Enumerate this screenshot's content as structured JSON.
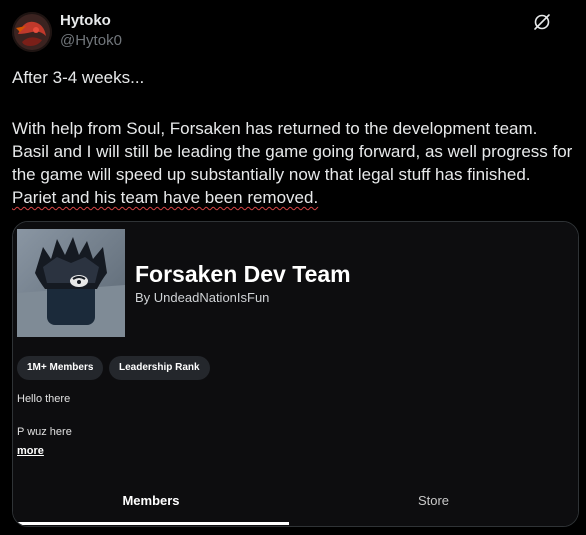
{
  "author": {
    "display_name": "Hytoko",
    "handle": "@Hytok0",
    "avatar_icon": "avatar-image"
  },
  "header_icons": {
    "grok_icon": "grok-icon"
  },
  "post": {
    "line1": "After 3-4 weeks...",
    "paragraph_main": "With help from Soul, Forsaken has returned to the development team. Basil and I will still be leading the game going forward, as well progress for the game will speed up substantially now that legal stuff has finished.",
    "paragraph_underlined": "Pariet and his team have been removed."
  },
  "card": {
    "title": "Forsaken Dev Team",
    "byline": "By UndeadNationIsFun",
    "badges": {
      "members": "1M+ Members",
      "rank": "Leadership Rank"
    },
    "description": {
      "line1": "Hello there",
      "line2": "P wuz here",
      "more": "more"
    },
    "tabs": {
      "members": "Members",
      "store": "Store"
    },
    "thumbnail_icon": "group-thumbnail-image"
  },
  "colors": {
    "background": "#000000",
    "text_primary": "#e7e9ea",
    "text_secondary": "#71767b",
    "card_border": "#2f3336",
    "spell_underline": "#d64545"
  }
}
